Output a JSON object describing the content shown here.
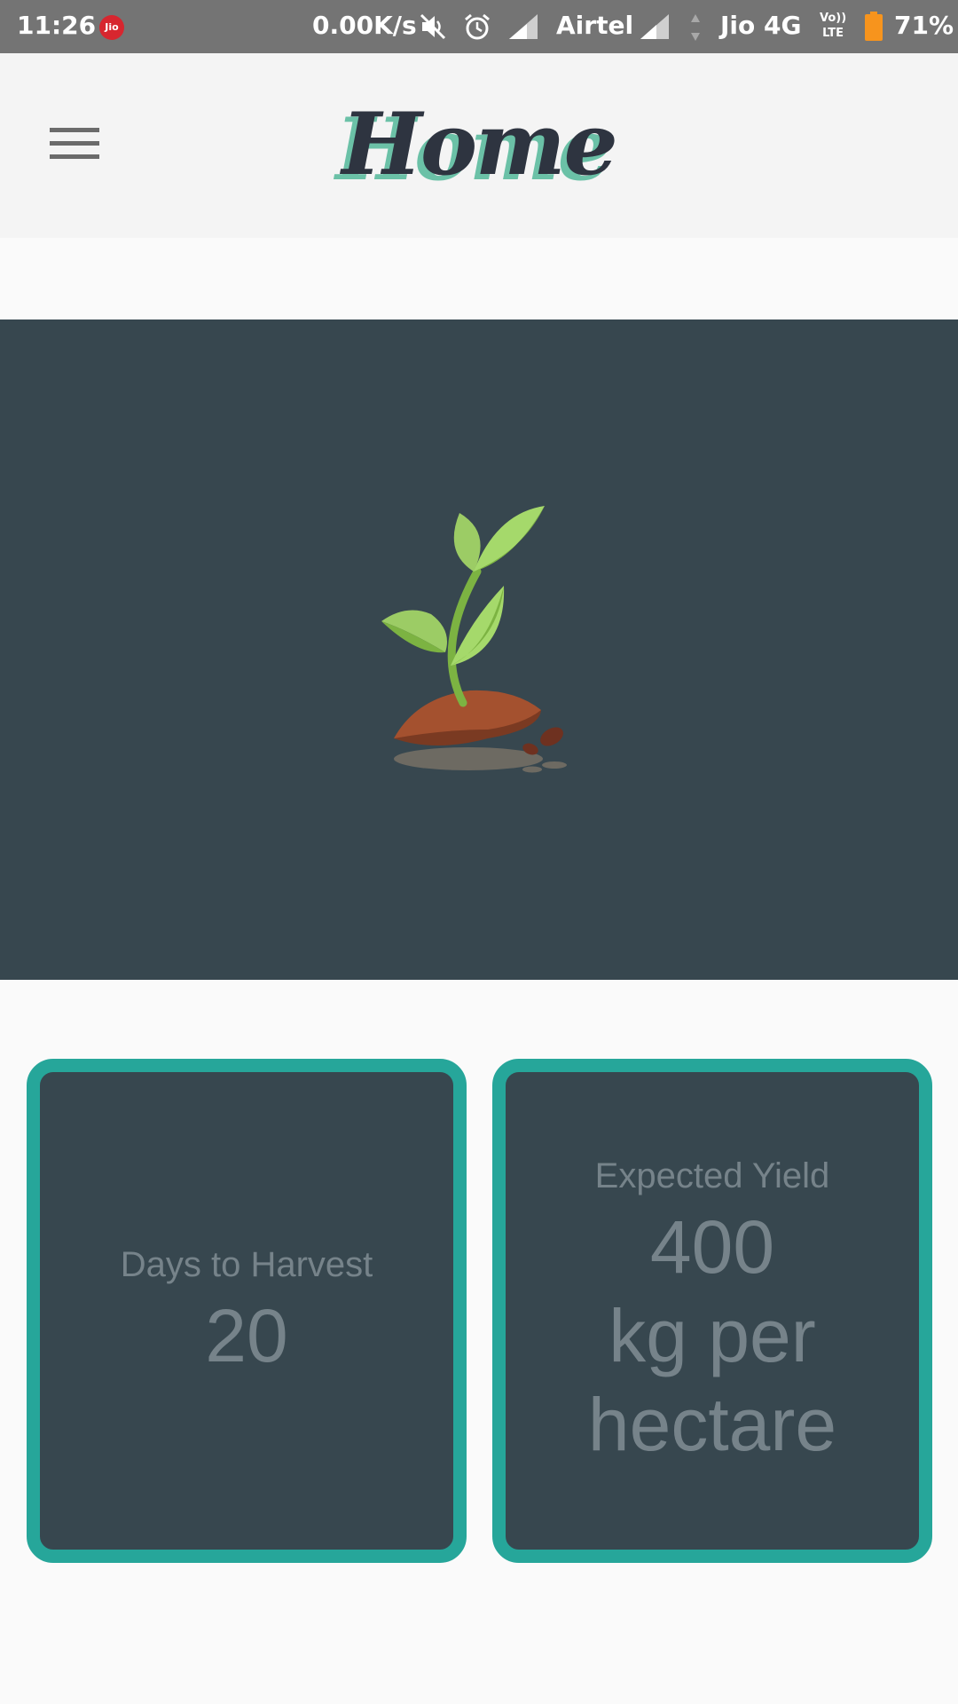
{
  "status_bar": {
    "time": "11:26",
    "jio_badge": "Jio",
    "network_speed": "0.00K/s",
    "carrier_1": "Airtel",
    "carrier_2": "Jio 4G",
    "volte_label_top": "Vo))",
    "volte_label_bottom": "LTE",
    "battery_percent": "71%",
    "battery_color": "#f7941d"
  },
  "header": {
    "title": "Home",
    "title_color": "#2e3440",
    "title_shadow_color": "#6bc1a7",
    "menu_icon": "hamburger-menu-icon"
  },
  "hero": {
    "background_color": "#37474f",
    "illustration": "sprouting-plant-illustration"
  },
  "cards": {
    "days_to_harvest": {
      "label": "Days to Harvest",
      "value": "20"
    },
    "expected_yield": {
      "label": "Expected Yield",
      "value": "400",
      "unit_line_1": "kg per",
      "unit_line_2": "hectare"
    },
    "border_color": "#26a69a"
  }
}
